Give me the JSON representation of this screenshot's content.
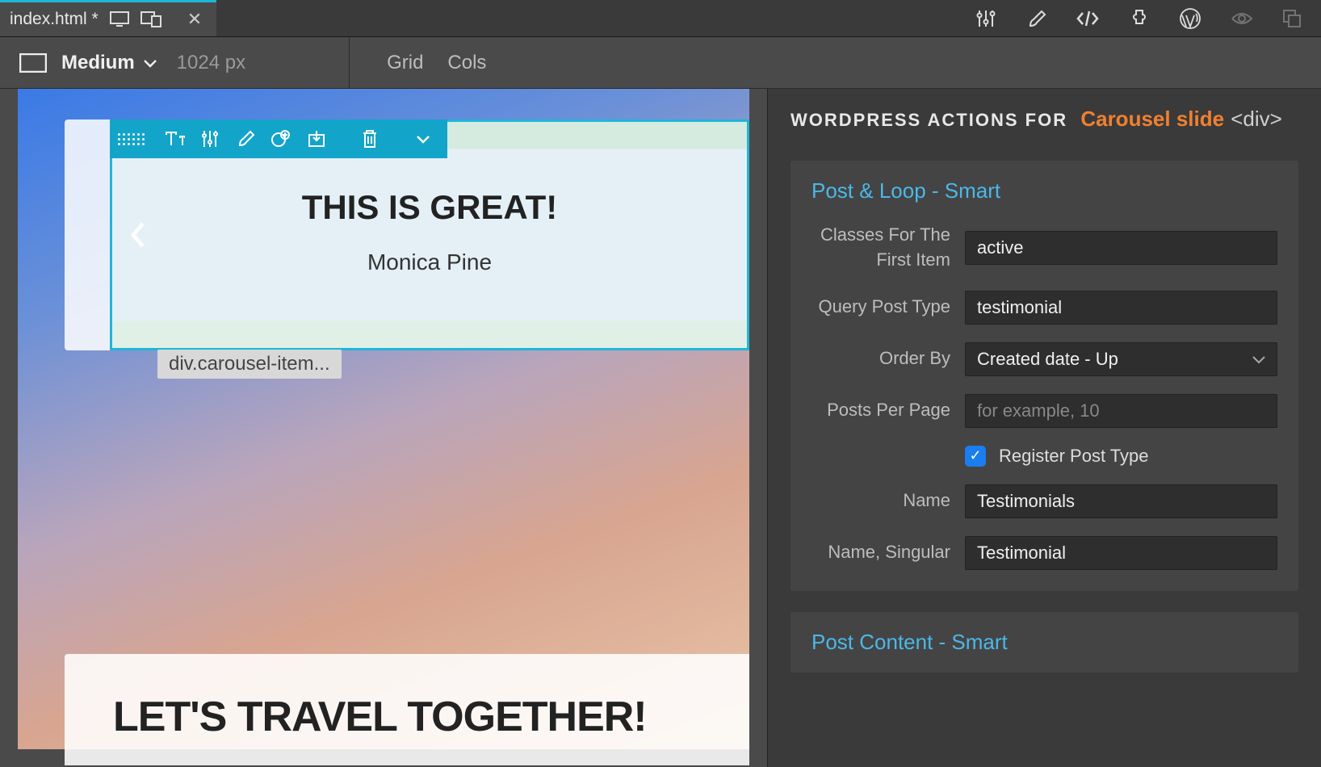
{
  "tab": {
    "filename": "index.html *"
  },
  "viewport": {
    "size_label": "Medium",
    "width_label": "1024 px",
    "grid_label": "Grid",
    "cols_label": "Cols"
  },
  "canvas": {
    "slide_title": "THIS IS GREAT!",
    "slide_author": "Monica Pine",
    "breadcrumb": "div.carousel-item...",
    "section2_title": "LET'S TRAVEL TOGETHER!"
  },
  "panel": {
    "header_prefix": "WORDPRESS ACTIONS FOR",
    "header_element": "Carousel slide",
    "header_tag": "<div>",
    "section1_title": "Post & Loop - Smart",
    "section2_title": "Post Content - Smart",
    "fields": {
      "classes_first_label": "Classes For The First Item",
      "classes_first_value": "active",
      "query_post_type_label": "Query Post Type",
      "query_post_type_value": "testimonial",
      "order_by_label": "Order By",
      "order_by_value": "Created date - Up",
      "posts_per_page_label": "Posts Per Page",
      "posts_per_page_placeholder": "for example, 10",
      "register_post_type_label": "Register Post Type",
      "name_label": "Name",
      "name_value": "Testimonials",
      "name_singular_label": "Name, Singular",
      "name_singular_value": "Testimonial"
    }
  }
}
